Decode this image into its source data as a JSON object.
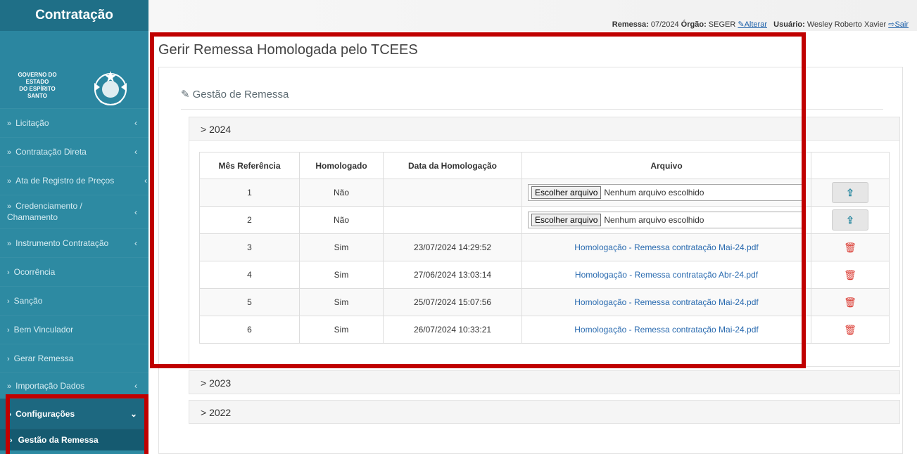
{
  "sidebar": {
    "brand": "Contratação",
    "gov_text": "GOVERNO DO ESTADO\nDO ESPÍRITO SANTO",
    "items": [
      {
        "marker": "»",
        "label": "Licitação",
        "caret": "‹"
      },
      {
        "marker": "»",
        "label": "Contratação Direta",
        "caret": "‹"
      },
      {
        "marker": "»",
        "label": "Ata de Registro de Preços",
        "caret": "‹"
      },
      {
        "marker": "»",
        "label": "Credenciamento / Chamamento",
        "caret": "‹"
      },
      {
        "marker": "»",
        "label": "Instrumento Contratação",
        "caret": "‹"
      },
      {
        "marker": "›",
        "label": "Ocorrência",
        "caret": ""
      },
      {
        "marker": "›",
        "label": "Sanção",
        "caret": ""
      },
      {
        "marker": "›",
        "label": "Bem Vinculador",
        "caret": ""
      },
      {
        "marker": "›",
        "label": "Gerar Remessa",
        "caret": ""
      },
      {
        "marker": "»",
        "label": "Importação Dados",
        "caret": "‹"
      },
      {
        "marker": "»",
        "label": "Configurações",
        "caret": "⌄"
      },
      {
        "marker": "›",
        "label": "Gestão da Remessa",
        "caret": ""
      }
    ]
  },
  "topbar": {
    "remessa_label": "Remessa:",
    "remessa_value": "07/2024",
    "orgao_label": "Órgão:",
    "orgao_value": "SEGER",
    "alterar": "Alterar",
    "usuario_label": "Usuário:",
    "usuario_value": "Wesley Roberto Xavier",
    "sair": "Sair"
  },
  "page_title": "Gerir Remessa Homologada pelo TCEES",
  "panel_title": "Gestão de Remessa",
  "years": [
    "2024",
    "2023",
    "2022"
  ],
  "table": {
    "headers": [
      "Mês Referência",
      "Homologado",
      "Data da Homologação",
      "Arquivo",
      ""
    ],
    "file_button": "Escolher arquivo",
    "file_none": "Nenhum arquivo escolhido",
    "rows": [
      {
        "mes": "1",
        "homologado": "Não",
        "data": "",
        "arquivo": ""
      },
      {
        "mes": "2",
        "homologado": "Não",
        "data": "",
        "arquivo": ""
      },
      {
        "mes": "3",
        "homologado": "Sim",
        "data": "23/07/2024 14:29:52",
        "arquivo": "Homologação - Remessa contratação Mai-24.pdf"
      },
      {
        "mes": "4",
        "homologado": "Sim",
        "data": "27/06/2024 13:03:14",
        "arquivo": "Homologação - Remessa contratação Abr-24.pdf"
      },
      {
        "mes": "5",
        "homologado": "Sim",
        "data": "25/07/2024 15:07:56",
        "arquivo": "Homologação - Remessa contratação Mai-24.pdf"
      },
      {
        "mes": "6",
        "homologado": "Sim",
        "data": "26/07/2024 10:33:21",
        "arquivo": "Homologação - Remessa contratação Mai-24.pdf"
      }
    ]
  },
  "colors": {
    "sidebar": "#2d8aa2",
    "highlight": "#c00000",
    "link": "#2a6bb0",
    "trash": "#d9342b"
  }
}
